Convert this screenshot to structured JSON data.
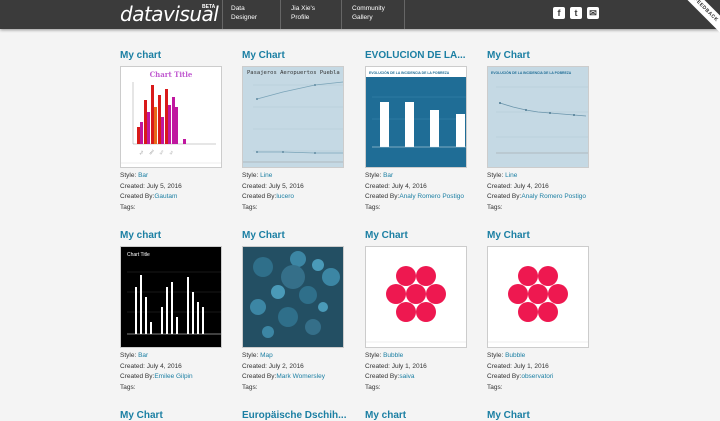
{
  "header": {
    "logo": "datavisual",
    "beta": "BETA",
    "nav": [
      {
        "label": "Data\nDesigner"
      },
      {
        "label": "Jia Xie's\nProfile"
      },
      {
        "label": "Community\nGallery"
      }
    ],
    "social": [
      {
        "icon": "facebook-icon",
        "glyph": "f"
      },
      {
        "icon": "twitter-icon",
        "glyph": "t"
      },
      {
        "icon": "mail-icon",
        "glyph": "✉"
      }
    ],
    "feedback": "FEEDBACK"
  },
  "labels": {
    "style": "Style: ",
    "created": "Created: ",
    "created_by": "Created By:",
    "tags": "Tags:"
  },
  "cards": [
    {
      "title": "My chart",
      "style": "Bar",
      "created": "July 5, 2016",
      "author": "Gautam",
      "thumb_text": "Chart Title"
    },
    {
      "title": "My Chart",
      "style": "Line",
      "created": "July 5, 2016",
      "author": "lucero",
      "thumb_text": "Pasajeros Aeropuertos Puebla"
    },
    {
      "title": "EVOLUCIÓN DE LA...",
      "style": "Bar",
      "created": "July 4, 2016",
      "author": "Analy Romero Postigo",
      "thumb_text": "EVOLUCIÓN DE LA INCIDENCIA DE LA POBREZA"
    },
    {
      "title": "My Chart",
      "style": "Line",
      "created": "July 4, 2016",
      "author": "Analy Romero Postigo",
      "thumb_text": "EVOLUCIÓN DE LA INCIDENCIA DE LA POBREZA"
    },
    {
      "title": "My chart",
      "style": "Bar",
      "created": "July 4, 2016",
      "author": "Emilee Gilpin",
      "thumb_text": "Chart Title"
    },
    {
      "title": "My Chart",
      "style": "Map",
      "created": "July 2, 2016",
      "author": "Mark Womersley",
      "thumb_text": ""
    },
    {
      "title": "My Chart",
      "style": "Bubble",
      "created": "July 1, 2016",
      "author": "saiva",
      "thumb_text": ""
    },
    {
      "title": "My Chart",
      "style": "Bubble",
      "created": "July 1, 2016",
      "author": "observatori",
      "thumb_text": ""
    },
    {
      "title": "My Chart"
    },
    {
      "title": "Europäische Dschih..."
    },
    {
      "title": "My chart"
    },
    {
      "title": "My Chart"
    }
  ]
}
